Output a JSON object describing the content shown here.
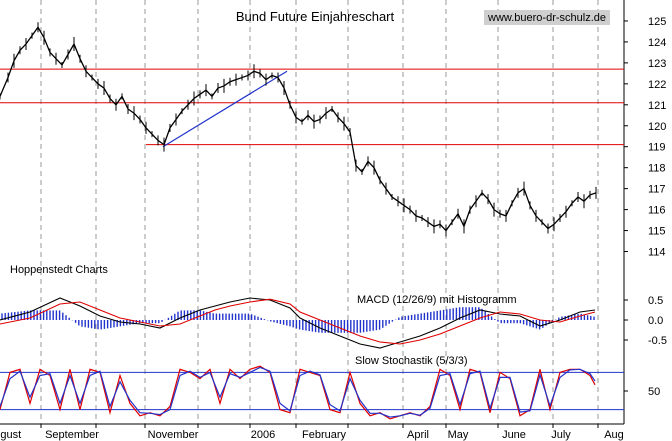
{
  "watermark": "www.buero-dr-schulz.de",
  "chart_data": [
    {
      "type": "line",
      "panel": "price",
      "title": "Bund Future Einjahreschart",
      "ylim": [
        113.5,
        126
      ],
      "yticks": [
        114,
        115,
        116,
        117,
        118,
        119,
        120,
        121,
        122,
        123,
        124,
        125
      ],
      "xlim": [
        0,
        608
      ],
      "xticks": [
        {
          "label": "August",
          "pos": 4
        },
        {
          "label": "September",
          "pos": 72
        },
        {
          "label": "November",
          "pos": 173
        },
        {
          "label": "2006",
          "pos": 263
        },
        {
          "label": "February",
          "pos": 324
        },
        {
          "label": "April",
          "pos": 418
        },
        {
          "label": "May",
          "pos": 458
        },
        {
          "label": "June",
          "pos": 514
        },
        {
          "label": "July",
          "pos": 561
        },
        {
          "label": "Aug",
          "pos": 614
        }
      ],
      "gridlines_x": [
        41,
        96,
        145,
        198,
        250,
        296,
        348,
        403,
        446,
        498,
        553,
        598
      ],
      "horizontal_lines": [
        122.7,
        121.1,
        119.1
      ],
      "trendline": [
        [
          163,
          119.0
        ],
        [
          287,
          122.6
        ]
      ],
      "series": [
        {
          "x": [
            0,
            8,
            14,
            20,
            26,
            32,
            38,
            44,
            50,
            56,
            62,
            68,
            74,
            80,
            86,
            92,
            98,
            104,
            110,
            116,
            122,
            128,
            134,
            140,
            146,
            152,
            158,
            164,
            170,
            176,
            182,
            188,
            194,
            200,
            206,
            212,
            218,
            224,
            230,
            236,
            242,
            248,
            254,
            260,
            266,
            272,
            278,
            284,
            290,
            296,
            302,
            308,
            314,
            320,
            326,
            332,
            338,
            344,
            350,
            356,
            362,
            368,
            374,
            380,
            386,
            392,
            398,
            404,
            410,
            416,
            422,
            428,
            434,
            440,
            446,
            452,
            458,
            464,
            470,
            476,
            482,
            488,
            494,
            500,
            506,
            512,
            518,
            524,
            530,
            536,
            542,
            548,
            554,
            560,
            566,
            572,
            578,
            584,
            590,
            596
          ],
          "close": [
            121.4,
            122.3,
            123.1,
            123.6,
            123.9,
            124.3,
            124.7,
            124.2,
            123.5,
            123.2,
            122.9,
            123.4,
            123.9,
            123.2,
            122.6,
            122.3,
            122.0,
            121.8,
            121.3,
            121.0,
            121.4,
            120.8,
            120.6,
            120.3,
            119.9,
            119.6,
            119.3,
            119.1,
            119.9,
            120.3,
            120.7,
            121.0,
            121.3,
            121.5,
            121.7,
            121.4,
            121.8,
            121.9,
            122.1,
            122.2,
            122.3,
            122.4,
            122.6,
            122.5,
            122.2,
            122.4,
            122.3,
            121.8,
            121.0,
            120.4,
            120.2,
            120.5,
            120.2,
            120.3,
            120.6,
            120.8,
            120.4,
            120.1,
            119.7,
            118.1,
            117.8,
            118.3,
            118.0,
            117.4,
            117.0,
            116.6,
            116.4,
            116.2,
            116.0,
            115.7,
            115.6,
            115.4,
            115.2,
            115.3,
            115.0,
            115.4,
            115.8,
            115.2,
            116.0,
            116.4,
            116.8,
            116.5,
            116.0,
            115.8,
            115.7,
            116.3,
            116.8,
            117.0,
            116.2,
            115.7,
            115.4,
            115.1,
            115.3,
            115.6,
            115.9,
            116.3,
            116.6,
            116.4,
            116.7,
            116.8
          ]
        }
      ]
    },
    {
      "type": "line",
      "panel": "macd",
      "label": "MACD (12/26/9) mit Histogramm",
      "ylim": [
        -0.8,
        0.8
      ],
      "yticks": [
        0.5,
        0.0,
        -0.5
      ],
      "series": [
        {
          "name": "MACD",
          "color": "#000000",
          "x": [
            0,
            30,
            60,
            80,
            100,
            120,
            140,
            160,
            180,
            200,
            215,
            230,
            250,
            270,
            290,
            300,
            320,
            340,
            360,
            380,
            400,
            420,
            440,
            460,
            480,
            500,
            520,
            540,
            560,
            580,
            595
          ],
          "values": [
            0.0,
            0.2,
            0.55,
            0.35,
            0.1,
            -0.05,
            -0.1,
            -0.2,
            0.05,
            0.25,
            0.35,
            0.45,
            0.55,
            0.5,
            0.3,
            0.05,
            -0.2,
            -0.4,
            -0.6,
            -0.7,
            -0.55,
            -0.4,
            -0.2,
            0.05,
            0.25,
            0.15,
            0.1,
            -0.15,
            0.0,
            0.2,
            0.25
          ]
        },
        {
          "name": "Signal",
          "color": "#e00000",
          "x": [
            0,
            30,
            60,
            80,
            100,
            120,
            140,
            160,
            180,
            200,
            215,
            230,
            250,
            270,
            290,
            300,
            320,
            340,
            360,
            380,
            400,
            420,
            440,
            460,
            480,
            500,
            520,
            540,
            560,
            580,
            595
          ],
          "values": [
            -0.1,
            0.05,
            0.4,
            0.45,
            0.25,
            0.05,
            -0.05,
            -0.15,
            -0.1,
            0.1,
            0.25,
            0.35,
            0.45,
            0.52,
            0.4,
            0.2,
            0.0,
            -0.2,
            -0.4,
            -0.55,
            -0.6,
            -0.5,
            -0.35,
            -0.15,
            0.05,
            0.2,
            0.15,
            0.0,
            -0.05,
            0.1,
            0.2
          ]
        }
      ],
      "histogram_color": "#2233cc"
    },
    {
      "type": "line",
      "panel": "stochastic",
      "label": "Slow Stochastik (5/3/3)",
      "ylim": [
        0,
        100
      ],
      "yticks": [
        50
      ],
      "levels": [
        20,
        80
      ],
      "series": [
        {
          "name": "%K",
          "color": "#e00000",
          "x": [
            0,
            10,
            20,
            30,
            40,
            50,
            60,
            70,
            80,
            90,
            100,
            110,
            120,
            130,
            140,
            150,
            160,
            170,
            180,
            190,
            200,
            210,
            220,
            230,
            240,
            250,
            260,
            270,
            280,
            290,
            300,
            310,
            320,
            330,
            340,
            350,
            360,
            370,
            380,
            390,
            400,
            410,
            420,
            430,
            440,
            450,
            460,
            470,
            480,
            490,
            500,
            510,
            520,
            530,
            540,
            550,
            560,
            570,
            580,
            590,
            595
          ],
          "values": [
            20,
            80,
            85,
            30,
            85,
            75,
            20,
            85,
            20,
            85,
            80,
            15,
            75,
            30,
            10,
            15,
            10,
            25,
            85,
            80,
            70,
            85,
            30,
            85,
            70,
            85,
            90,
            80,
            20,
            15,
            85,
            80,
            75,
            20,
            15,
            80,
            30,
            10,
            15,
            5,
            10,
            15,
            10,
            25,
            85,
            75,
            20,
            85,
            80,
            15,
            80,
            70,
            10,
            20,
            85,
            20,
            80,
            85,
            85,
            75,
            60
          ]
        },
        {
          "name": "%D",
          "color": "#2233cc",
          "x": [
            0,
            10,
            20,
            30,
            40,
            50,
            60,
            70,
            80,
            90,
            100,
            110,
            120,
            130,
            140,
            150,
            160,
            170,
            180,
            190,
            200,
            210,
            220,
            230,
            240,
            250,
            260,
            270,
            280,
            290,
            300,
            310,
            320,
            330,
            340,
            350,
            360,
            370,
            380,
            390,
            400,
            410,
            420,
            430,
            440,
            450,
            460,
            470,
            480,
            490,
            500,
            510,
            520,
            530,
            540,
            550,
            560,
            570,
            580,
            590,
            595
          ],
          "values": [
            25,
            70,
            82,
            40,
            75,
            78,
            30,
            75,
            30,
            75,
            82,
            25,
            65,
            35,
            15,
            14,
            12,
            20,
            75,
            82,
            72,
            80,
            40,
            78,
            72,
            80,
            88,
            82,
            30,
            18,
            75,
            82,
            76,
            28,
            18,
            70,
            35,
            14,
            14,
            8,
            10,
            14,
            11,
            22,
            75,
            78,
            28,
            78,
            82,
            22,
            72,
            72,
            16,
            18,
            76,
            26,
            72,
            84,
            85,
            78,
            66
          ]
        }
      ]
    }
  ]
}
